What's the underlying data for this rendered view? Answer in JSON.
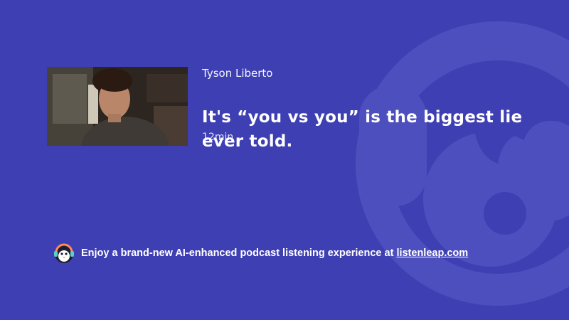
{
  "episode": {
    "author": "Tyson Liberto",
    "title": "It's “you vs you” is the biggest lie ever told.",
    "duration": "12min"
  },
  "promo": {
    "text": "Enjoy a brand-new AI-enhanced podcast listening experience at ",
    "link_label": "listenleap.com"
  },
  "icons": {
    "background": "headphone-mascot-icon",
    "promo": "penguin-logo-icon"
  },
  "colors": {
    "background": "#3e3fb2",
    "mascot_overlay": "#5a5cc6",
    "text": "#ffffff"
  }
}
